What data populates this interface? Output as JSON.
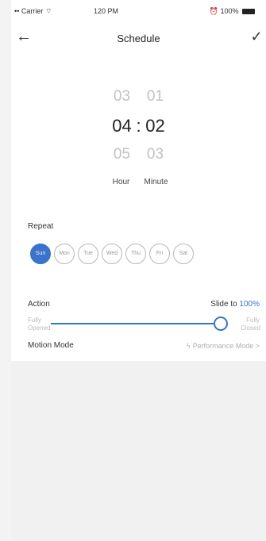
{
  "status_bar": {
    "carrier": "Carrier",
    "time": "120 PM",
    "battery": "100%"
  },
  "nav": {
    "title": "Schedule",
    "back_icon": "back-arrow-icon",
    "confirm_icon": "checkmark-icon"
  },
  "time_picker": {
    "prev": {
      "hour": "03",
      "minute": "01"
    },
    "selected": {
      "hour": "04",
      "minute": "02"
    },
    "next": {
      "hour": "05",
      "minute": "03"
    },
    "separator": ":",
    "hour_label": "Hour",
    "minute_label": "Minute"
  },
  "repeat": {
    "label": "Repeat",
    "days": [
      "Sun",
      "Mon",
      "Tue",
      "Wed",
      "Thu",
      "Fri",
      "Sat"
    ],
    "active_day": "Sun"
  },
  "action": {
    "label": "Action",
    "slide_prefix": "Slide to",
    "slide_value": "100%",
    "slider_fraction": 1.0,
    "left_label_1": "Fully",
    "left_label_2": "Opened",
    "right_label_1": "Fully",
    "right_label_2": "Closed"
  },
  "motion": {
    "label": "Motion Mode",
    "value": "Performance Mode",
    "chevron": ">"
  },
  "colors": {
    "accent": "#3a73c9"
  }
}
